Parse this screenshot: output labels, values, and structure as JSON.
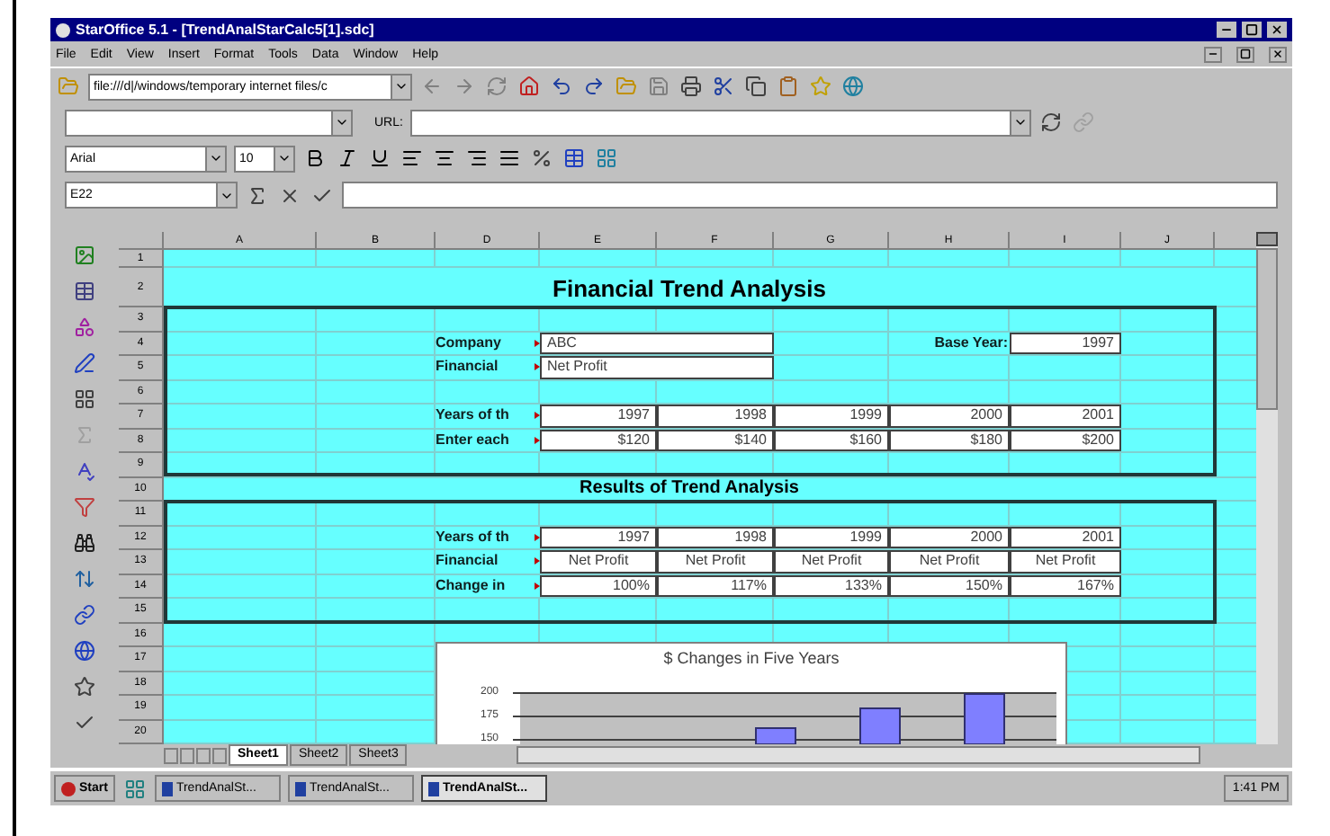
{
  "window": {
    "title": "StarOffice 5.1 - [TrendAnalStarCalc5[1].sdc]"
  },
  "menu": [
    "File",
    "Edit",
    "View",
    "Insert",
    "Format",
    "Tools",
    "Data",
    "Window",
    "Help"
  ],
  "function_bar": {
    "location": "file:///d|/windows/temporary internet files/c"
  },
  "hyperlink_bar": {
    "url_label": "URL:"
  },
  "format_bar": {
    "font": "Arial",
    "size": "10"
  },
  "formula_bar": {
    "cell_ref": "E22"
  },
  "sheet": {
    "columns": [
      "A",
      "B",
      "D",
      "E",
      "F",
      "G",
      "H",
      "I",
      "J"
    ],
    "row_numbers": [
      "1",
      "2",
      "3",
      "4",
      "5",
      "6",
      "7",
      "8",
      "9",
      "10",
      "11",
      "12",
      "13",
      "14",
      "15",
      "16",
      "17",
      "18",
      "19",
      "20"
    ],
    "title": "Financial Trend Analysis",
    "inputs": [
      {
        "label": "Company",
        "value": "ABC"
      },
      {
        "label": "Financial",
        "value": "Net Profit"
      }
    ],
    "base_year": {
      "label": "Base Year:",
      "value": "1997"
    },
    "input_rows": [
      {
        "label": "Years of th",
        "kind": "number",
        "cells": [
          "1997",
          "1998",
          "1999",
          "2000",
          "2001"
        ]
      },
      {
        "label": "Enter each",
        "kind": "number",
        "cells": [
          "$120",
          "$140",
          "$160",
          "$180",
          "$200"
        ]
      }
    ],
    "results_title": "Results of Trend Analysis",
    "result_rows": [
      {
        "label": "Years of th",
        "kind": "number",
        "cells": [
          "1997",
          "1998",
          "1999",
          "2000",
          "2001"
        ]
      },
      {
        "label": "Financial",
        "kind": "text",
        "cells": [
          "Net Profit",
          "Net Profit",
          "Net Profit",
          "Net Profit",
          "Net Profit"
        ]
      },
      {
        "label": "Change in",
        "kind": "number",
        "cells": [
          "100%",
          "117%",
          "133%",
          "150%",
          "167%"
        ]
      }
    ],
    "chart": {
      "title": "$ Changes in Five Years",
      "tick_labels": [
        "200",
        "175",
        "150"
      ]
    }
  },
  "sheet_tabs": [
    {
      "label": "Sheet1",
      "selected": true
    },
    {
      "label": "Sheet2",
      "selected": false
    },
    {
      "label": "Sheet3",
      "selected": false
    }
  ],
  "taskbar": {
    "start": "Start",
    "tasks": [
      {
        "label": "TrendAnalSt...",
        "selected": false
      },
      {
        "label": "TrendAnalSt...",
        "selected": false
      },
      {
        "label": "TrendAnalSt...",
        "selected": true
      }
    ],
    "clock": "1:41 PM"
  }
}
